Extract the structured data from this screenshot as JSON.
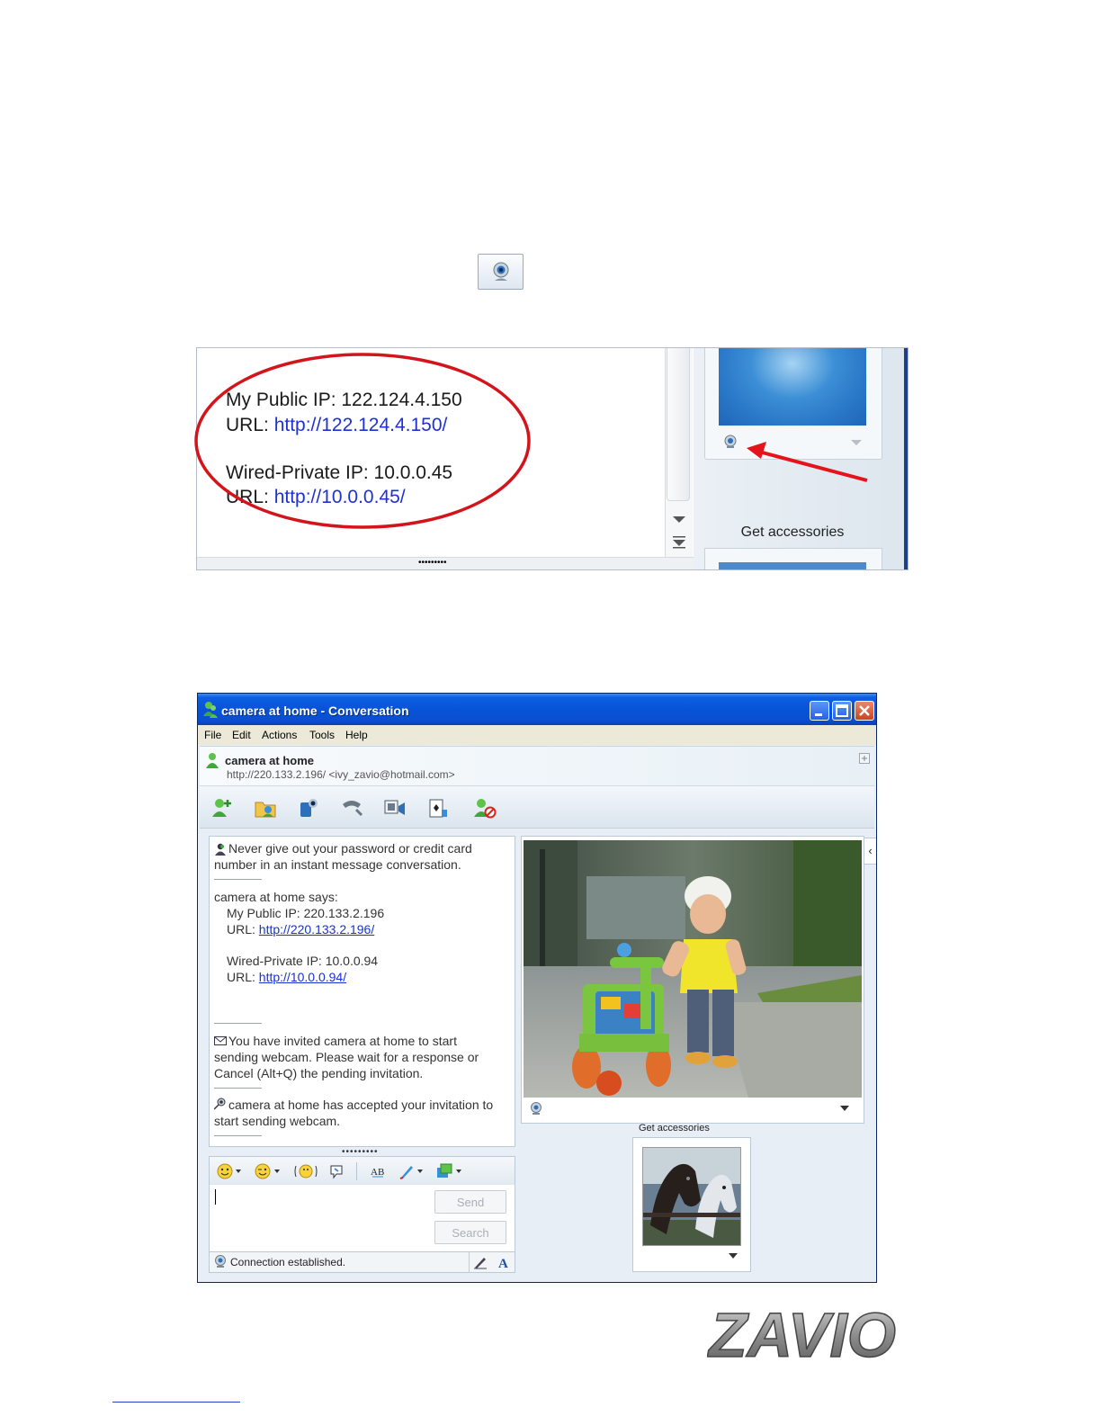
{
  "zoom": {
    "public_ip_label": "My Public IP: 122.124.4.150",
    "url_prefix": "URL: ",
    "public_url": "http://122.124.4.150/",
    "private_ip_label": "Wired-Private IP: 10.0.0.45",
    "private_url": "http://10.0.0.45/",
    "get_accessories": "Get accessories",
    "grip": "•••••••••"
  },
  "window": {
    "title": "camera at home - Conversation",
    "menu": [
      "File",
      "Edit",
      "Actions",
      "Tools",
      "Help"
    ],
    "contact_name": "camera at home",
    "contact_address": "http://220.133.2.196/  <ivy_zavio@hotmail.com>",
    "history": {
      "warning_1": "Never give out your password or credit card",
      "warning_2": "number in an instant message conversation.",
      "says": "camera at home says:",
      "public_ip": "My Public IP: 220.133.2.196",
      "url_prefix": "URL: ",
      "public_url": "http://220.133.2.196/",
      "private_ip": "Wired-Private IP: 10.0.0.94",
      "private_url": "http://10.0.0.94/",
      "invite_1": "You have invited camera at home to start",
      "invite_2": "sending webcam. Please wait for a response or",
      "invite_3": "Cancel (Alt+Q) the pending invitation.",
      "accept_1": "camera at home has accepted your invitation to",
      "accept_2": "start sending webcam."
    },
    "grip": "•••••••••",
    "send_label": "Send",
    "search_label": "Search",
    "status": "Connection established.",
    "get_accessories": "Get accessories",
    "side_arrow": "‹"
  },
  "colors": {
    "link": "#1732d4",
    "title_bar": "#0853d8",
    "circle": "#d4141b",
    "arrow": "#e3141b"
  },
  "logo": "ZAVIO"
}
